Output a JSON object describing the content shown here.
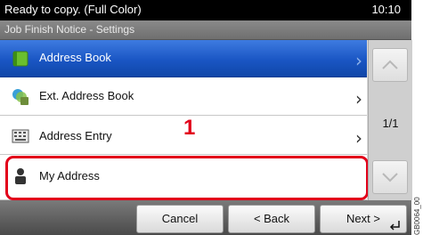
{
  "status": {
    "message": "Ready to copy. (Full Color)",
    "time": "10:10"
  },
  "title": "Job Finish Notice - Settings",
  "list": {
    "items": [
      {
        "label": "Address Book",
        "icon": "address-book-icon",
        "selected": true
      },
      {
        "label": "Ext. Address Book",
        "icon": "ext-address-book-icon"
      },
      {
        "label": "Address Entry",
        "icon": "keyboard-icon"
      },
      {
        "label": "My Address",
        "icon": "user-icon"
      }
    ]
  },
  "callout": "1",
  "pager": {
    "text": "1/1"
  },
  "buttons": {
    "cancel": "Cancel",
    "back": "< Back",
    "next": "Next >"
  },
  "figure_id": "GB0064_00",
  "colors": {
    "highlight": "#e2001a",
    "selected_row": "#1a56c4"
  }
}
